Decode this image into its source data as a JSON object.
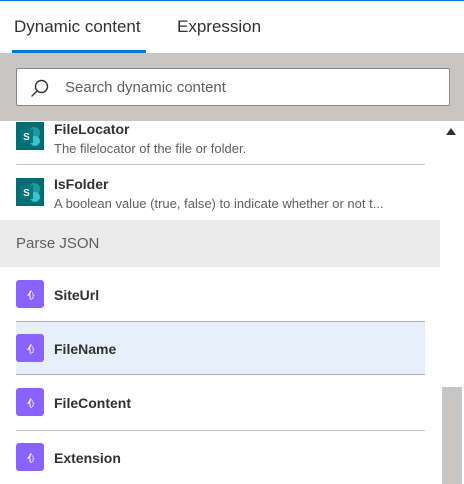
{
  "tabs": [
    {
      "label": "Dynamic content",
      "active": true
    },
    {
      "label": "Expression",
      "active": false
    }
  ],
  "search": {
    "placeholder": "Search dynamic content",
    "value": ""
  },
  "items_top": [
    {
      "title": "FileLocator",
      "description": "The filelocator of the file or folder.",
      "icon": "sharepoint-icon"
    },
    {
      "title": "IsFolder",
      "description": "A boolean value (true, false) to indicate whether or not t...",
      "icon": "sharepoint-icon"
    }
  ],
  "section": {
    "title": "Parse JSON"
  },
  "items_json": [
    {
      "title": "SiteUrl",
      "icon": "parse-json-icon",
      "selected": false
    },
    {
      "title": "FileName",
      "icon": "parse-json-icon",
      "selected": true
    },
    {
      "title": "FileContent",
      "icon": "parse-json-icon",
      "selected": false
    },
    {
      "title": "Extension",
      "icon": "parse-json-icon",
      "selected": false
    }
  ],
  "icons": {
    "sharepoint_letter": "S"
  },
  "colors": {
    "accent": "#0078d4",
    "sharepoint": "#036c70",
    "parse_json": "#8a63ff",
    "selected_row": "#e5f0fb"
  }
}
